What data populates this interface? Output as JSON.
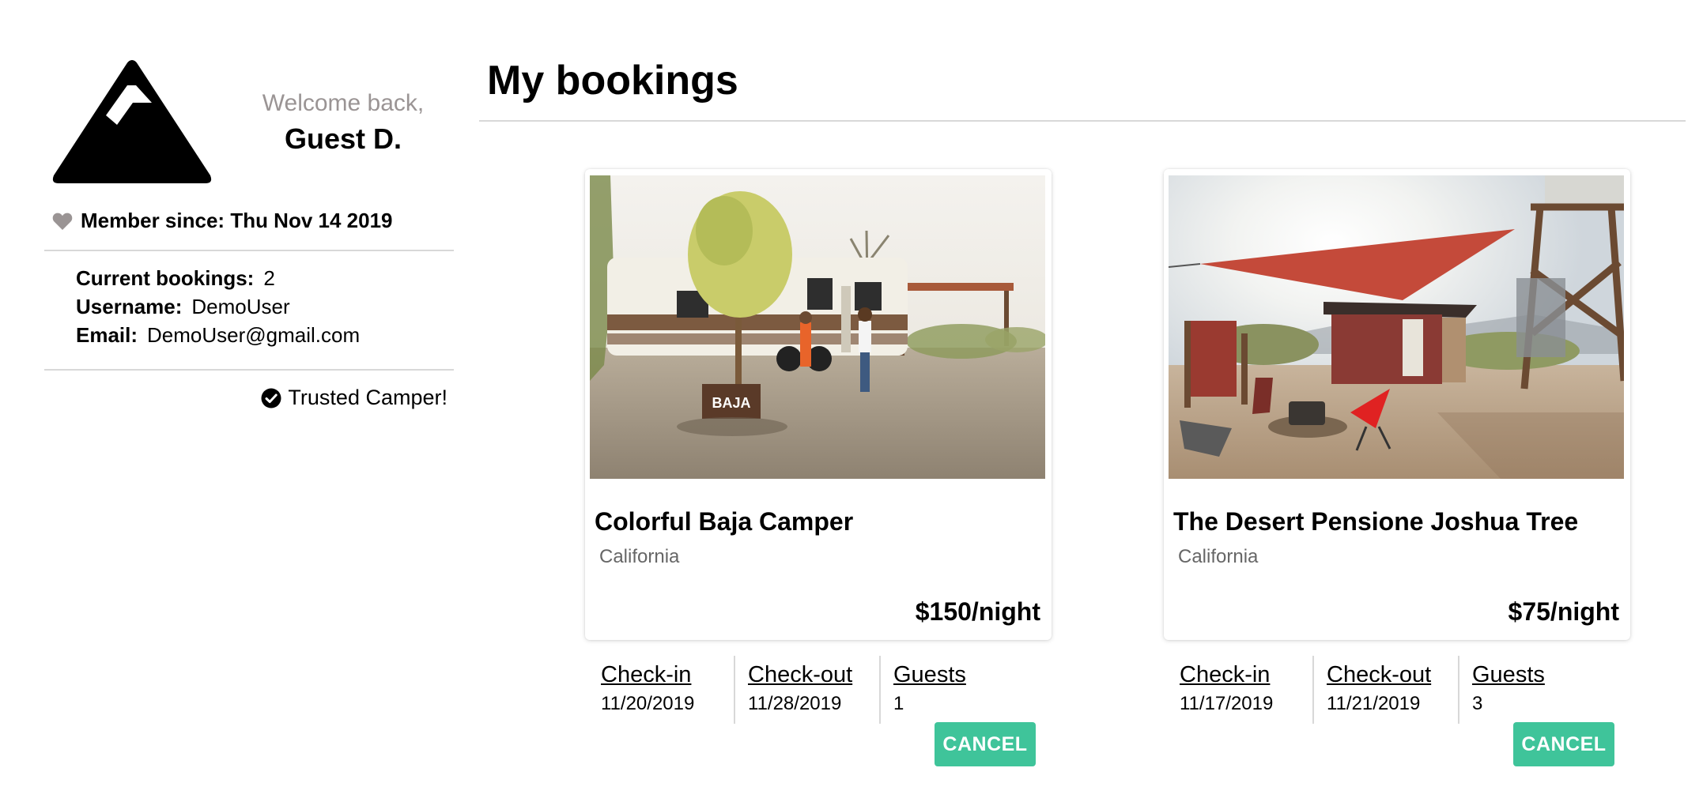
{
  "user": {
    "welcome_text": "Welcome back,",
    "name": "Guest D.",
    "member_since_label": "Member since:",
    "member_since_value": "Thu Nov 14 2019",
    "info": [
      {
        "label": "Current bookings:",
        "value": "2"
      },
      {
        "label": "Username:",
        "value": "DemoUser"
      },
      {
        "label": "Email:",
        "value": "DemoUser@gmail.com"
      }
    ],
    "trusted_label": "Trusted Camper!"
  },
  "main": {
    "title": "My bookings"
  },
  "bookings": [
    {
      "title": "Colorful Baja Camper",
      "location": "California",
      "price": "$150/night",
      "checkin_label": "Check-in",
      "checkin": "11/20/2019",
      "checkout_label": "Check-out",
      "checkout": "11/28/2019",
      "guests_label": "Guests",
      "guests": "1",
      "cancel_label": "CANCEL",
      "sign_text": "BAJA"
    },
    {
      "title": "The Desert Pensione Joshua Tree",
      "location": "California",
      "price": "$75/night",
      "checkin_label": "Check-in",
      "checkin": "11/17/2019",
      "checkout_label": "Check-out",
      "checkout": "11/21/2019",
      "guests_label": "Guests",
      "guests": "3",
      "cancel_label": "CANCEL"
    }
  ],
  "colors": {
    "accent": "#3fc49a",
    "muted_text": "#9a9494",
    "heart": "#9a9494",
    "divider": "#d8d8d8"
  },
  "icons": [
    "mountain-logo-icon",
    "heart-icon",
    "check-circle-icon"
  ]
}
